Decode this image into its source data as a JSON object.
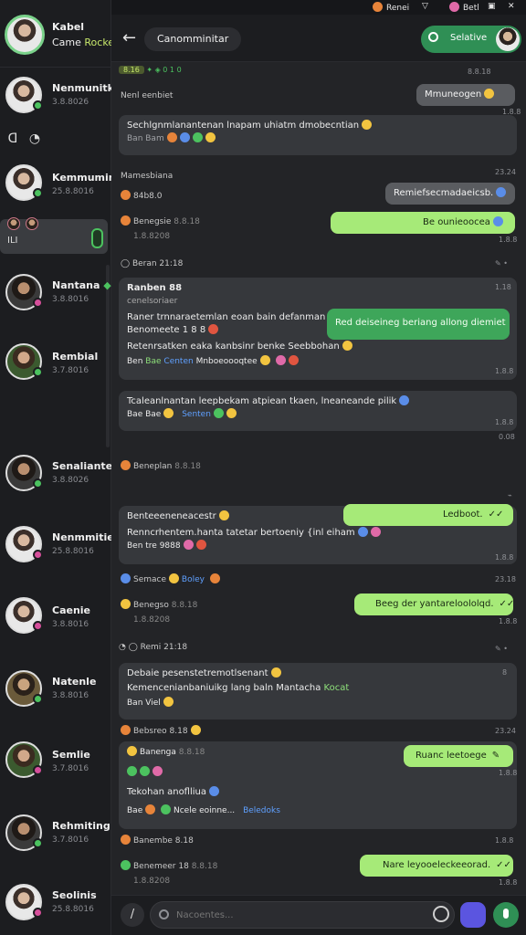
{
  "profile": {
    "name": "Kabel",
    "status_prefix": "Came",
    "status_hl": "Rocket"
  },
  "sidebar": {
    "items": [
      {
        "name": "Nenmunitkoa",
        "time": "3.8.8026"
      },
      {
        "name": "Kemmuminta",
        "time": "25.8.8016"
      },
      {
        "name": "Nantana",
        "time": "3.8.8016"
      },
      {
        "name": "Rembial",
        "time": "3.7.8016"
      },
      {
        "name": "Senaliante",
        "time": "3.8.8026"
      },
      {
        "name": "Nenmmitie",
        "time": "25.8.8016"
      },
      {
        "name": "Caenie",
        "time": "3.8.8016"
      },
      {
        "name": "Natenle",
        "time": "3.8.8016"
      },
      {
        "name": "Semlie",
        "time": "3.7.8016"
      },
      {
        "name": "Rehmiting",
        "time": "3.7.8016"
      },
      {
        "name": "Seolinis",
        "time": "25.8.8016"
      }
    ],
    "active_code": "ILI"
  },
  "topbar": {
    "item1": "Renei",
    "item2": "Betl"
  },
  "header": {
    "title": "Canomminitar",
    "search_label": "Selative"
  },
  "chat": {
    "date_tag": "8.16",
    "m1_sender": "Nenl eenbiet",
    "m1_bubble": "Mmuneogen",
    "m1_time": "1.8.8",
    "m2_text": "Sechlgnmlanantenan lnapam uhiatm dmobecntian",
    "m2_meta": "Ban Bam",
    "m3_sender": "Mamesbiana",
    "m3_time": "23.24",
    "m3_sub": "84b8.0",
    "m3_bubble": "Remiefsecmadaeicsb.",
    "m4_sender": "Benegsie",
    "m4_tag": "8.8.18",
    "m4_sub": "1.8.8208",
    "m4_bubble": "Be ounieoocea",
    "m4_time": "1.8.8",
    "m5_sender": "Beran 21:18",
    "m6_head": "Ranben 88",
    "m6_sub": "cenelsoriaer",
    "m6_line1": "Raner trnnaraetemlan eoan bain defanman",
    "m6_line2": "Benomeete 1 8 8",
    "m6_line3": "Retenrsatken eaka kanbsinr benke Seebbohan",
    "m6_meta_a": "Ben",
    "m6_meta_b": "Bae",
    "m6_meta_c": "Centen",
    "m6_meta_d": "Mnboeoooqtee",
    "m6_overlay": "Red deiseineg beriang allong diemiet",
    "m6_time": "1.8.8",
    "m7_text": "Tcaleanlnantan leepbekam atpiean tkaen, lneaneande pilik",
    "m7_meta_a": "Bae Bae",
    "m7_meta_b": "Senten",
    "m7_time": "1.8.8",
    "m8_sender": "Beneplan",
    "m8_tag": "8.8.18",
    "m9_head": "Benteeeneneacestr",
    "m9_bubble": "Ledboot.",
    "m9_line": "Renncrhentem.hanta tatetar bertoeniy {inl eiham",
    "m9_meta": "Ben tre 9888",
    "m9_time": "1.8.8",
    "m10_sender": "Semace",
    "m10_tag": "Boley",
    "m10_time": "23.18",
    "m11_sender": "Benegso",
    "m11_tag": "8.8.18",
    "m11_sub": "1.8.8208",
    "m11_bubble": "Beeg der yantareloololqd.",
    "m11_time": "1.8.8",
    "m12_sender": "Remi 21:18",
    "m13_line1": "Debaie pesenstetremotlsenant",
    "m13_line2": "Kemencenianbaniuikg lang baln Mantacha",
    "m13_hl": "Kocat",
    "m13_meta": "Ban Viel",
    "m14_sender": "Bebsreo 8.18",
    "m14_time": "23.24",
    "m15_sender": "Banenga",
    "m15_tag": "8.8.18",
    "m15_bubble": "Ruanc leetoege",
    "m15_time": "1.8.8",
    "m15_line": "Tekohan anoflliua",
    "m15_meta_a": "Bae",
    "m15_meta_b": "Ncele eoinne...",
    "m15_link": "Beledoks",
    "m16_sender": "Banembe 8.18",
    "m16_time": "1.8.8",
    "m17_sender": "Benemeer 18",
    "m17_tag": "8.8.18",
    "m17_sub": "1.8.8208",
    "m17_bubble": "Nare leyooeleckeeorad.",
    "m17_time": "1.8.8"
  },
  "composer": {
    "placeholder": "Nacoentes..."
  }
}
